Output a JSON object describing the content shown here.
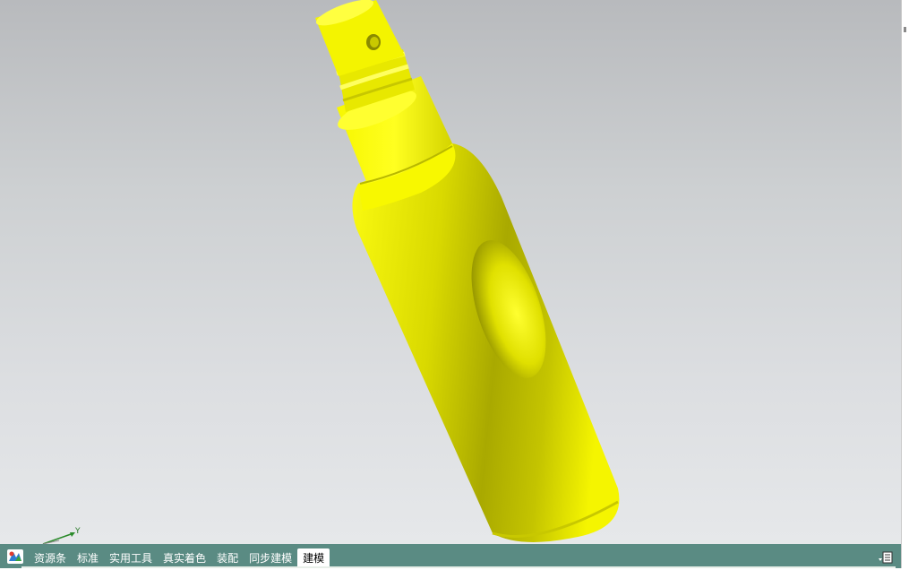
{
  "viewport": {
    "background_top": "#b8babd",
    "background_bottom": "#e6e8ea"
  },
  "model": {
    "body_color": "#f0f000",
    "shadow_color": "#8c8c00",
    "highlight_color": "#ffff55"
  },
  "triad": {
    "y_label": "Y"
  },
  "bottom_bar": {
    "background": "#5a8b83",
    "logo_icon": "nx-logo-icon",
    "tabs": [
      {
        "label": "资源条",
        "active": false
      },
      {
        "label": "标准",
        "active": false
      },
      {
        "label": "实用工具",
        "active": false
      },
      {
        "label": "真实着色",
        "active": false
      },
      {
        "label": "装配",
        "active": false
      },
      {
        "label": "同步建模",
        "active": false
      },
      {
        "label": "建模",
        "active": true
      }
    ],
    "menu_icon": "panel-menu-icon"
  }
}
